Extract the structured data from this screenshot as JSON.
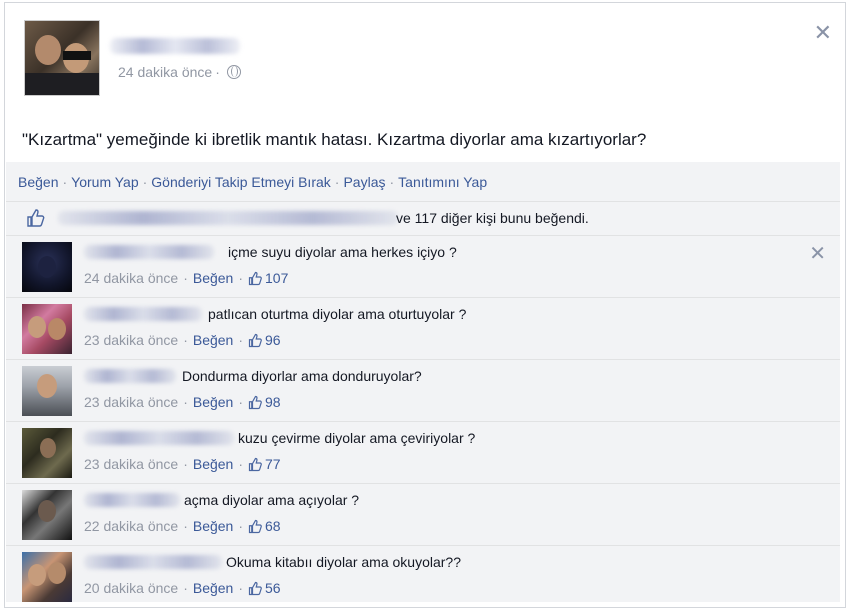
{
  "post": {
    "time": "24 dakika önce",
    "status_text": "\"Kızartma\" yemeğinde ki ibretlik mantık hatası. Kızartma diyorlar ama kızartıyorlar?"
  },
  "actions": {
    "like": "Beğen",
    "comment": "Yorum Yap",
    "unfollow": "Gönderiyi Takip Etmeyi Bırak",
    "share": "Paylaş",
    "promote": "Tanıtımını Yap"
  },
  "likes": {
    "text": "ve 117 diğer kişi bunu beğendi."
  },
  "comment_like_label": "Beğen",
  "comments": [
    {
      "text": "içme suyu diyolar ama herkes içiyo ?",
      "time": "24 dakika önce",
      "likes": "107"
    },
    {
      "text": "patlıcan oturtma diyolar ama oturtuyolar ?",
      "time": "23 dakika önce",
      "likes": "96"
    },
    {
      "text": "Dondurma diyorlar ama donduruyolar?",
      "time": "23 dakika önce",
      "likes": "98"
    },
    {
      "text": "kuzu çevirme diyolar ama çeviriyolar ?",
      "time": "23 dakika önce",
      "likes": "77"
    },
    {
      "text": "açma diyolar ama açıyolar ?",
      "time": "22 dakika önce",
      "likes": "68"
    },
    {
      "text": "Okuma kitabıı diyolar ama okuyolar??",
      "time": "20 dakika önce",
      "likes": "56"
    }
  ],
  "icons": {
    "close": "close-icon",
    "privacy": "globe-icon",
    "like": "thumbs-up-icon"
  },
  "colors": {
    "link": "#3b5998",
    "meta": "#9197a3",
    "ufi_background": "#f2f3f5"
  }
}
